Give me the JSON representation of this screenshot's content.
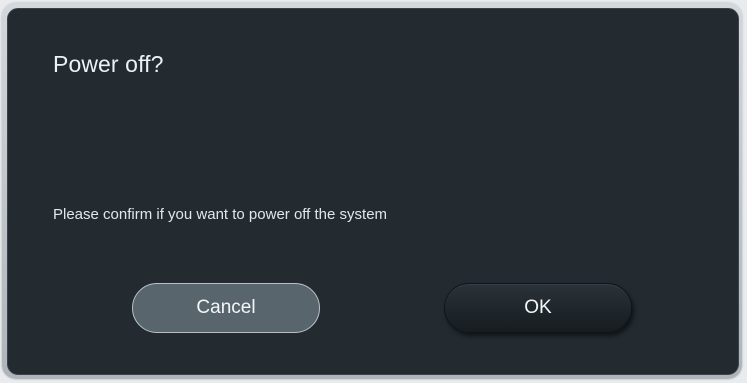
{
  "dialog": {
    "title": "Power off?",
    "message": "Please confirm if you want to power off the system",
    "cancel_label": "Cancel",
    "ok_label": "OK"
  },
  "colors": {
    "dialog_background": "#232b31",
    "cancel_button": "#58656d",
    "ok_button": "#1c2328",
    "text": "#eef1f3"
  }
}
